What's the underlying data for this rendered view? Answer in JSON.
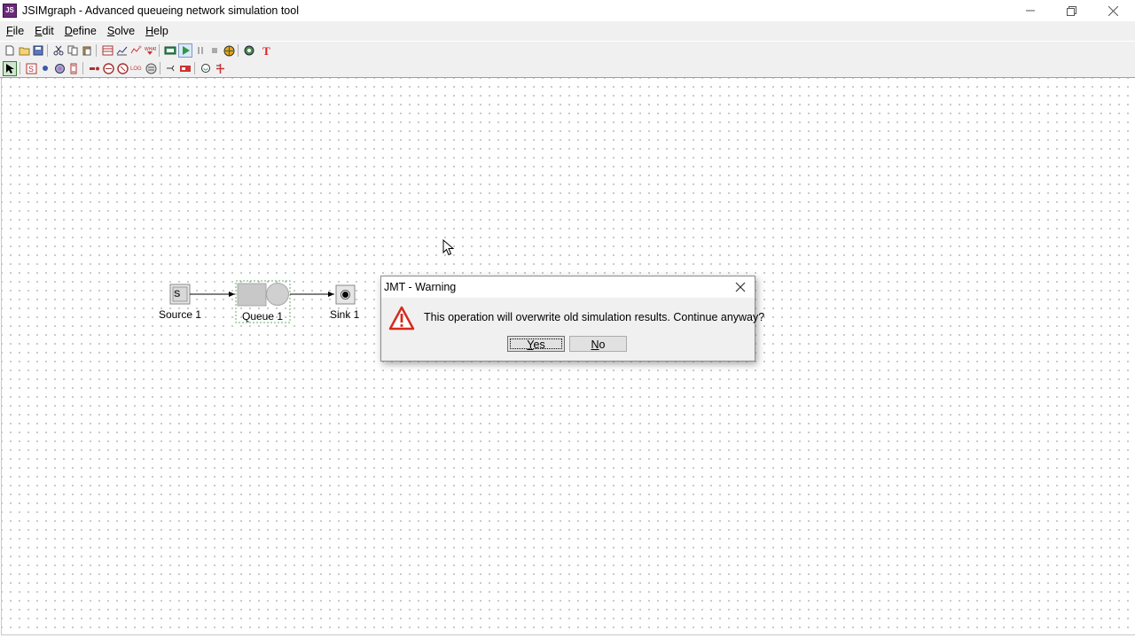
{
  "window": {
    "title": "JSIMgraph - Advanced queueing network simulation tool",
    "app_icon": "JS"
  },
  "menu": [
    {
      "rest": "ile",
      "underline": "F"
    },
    {
      "rest": "dit",
      "underline": "E"
    },
    {
      "rest": "efine",
      "underline": "D"
    },
    {
      "rest": "olve",
      "underline": "S"
    },
    {
      "rest": "elp",
      "underline": "H"
    }
  ],
  "toolbar_icons": [
    "new-icon",
    "open-icon",
    "save-icon",
    "cut-icon",
    "copy-icon",
    "paste-icon",
    "define-classes-icon",
    "station-params-icon",
    "performance-indices-icon",
    "what-if-icon",
    "export-icon",
    "start-simulation-icon",
    "pause-simulation-icon",
    "stop-simulation-icon",
    "simulation-params-icon",
    "jmva-icon",
    "text-label-icon"
  ],
  "palette_icons": [
    "select-icon",
    "source-icon",
    "sink-icon",
    "router-icon",
    "delay-icon",
    "queue-icon",
    "fork-icon",
    "join-icon",
    "logger-icon",
    "class-switch-icon",
    "semaphore-icon",
    "connection-icon",
    "place-icon",
    "transition-icon",
    "scaler-icon",
    "finite-capacity-icon"
  ],
  "canvas": {
    "nodes": [
      {
        "label": "Source 1",
        "symbol": "S"
      },
      {
        "label": "Queue 1"
      },
      {
        "label": "Sink 1"
      }
    ]
  },
  "dialog": {
    "title": "JMT - Warning",
    "message": "This operation will overwrite old simulation results. Continue anyway?",
    "yes": {
      "underline": "Y",
      "rest": "es"
    },
    "no": {
      "underline": "N",
      "rest": "o"
    }
  },
  "colors": {
    "warning_red": "#d52b1e",
    "canvas_dot": "#9a9a9a"
  }
}
